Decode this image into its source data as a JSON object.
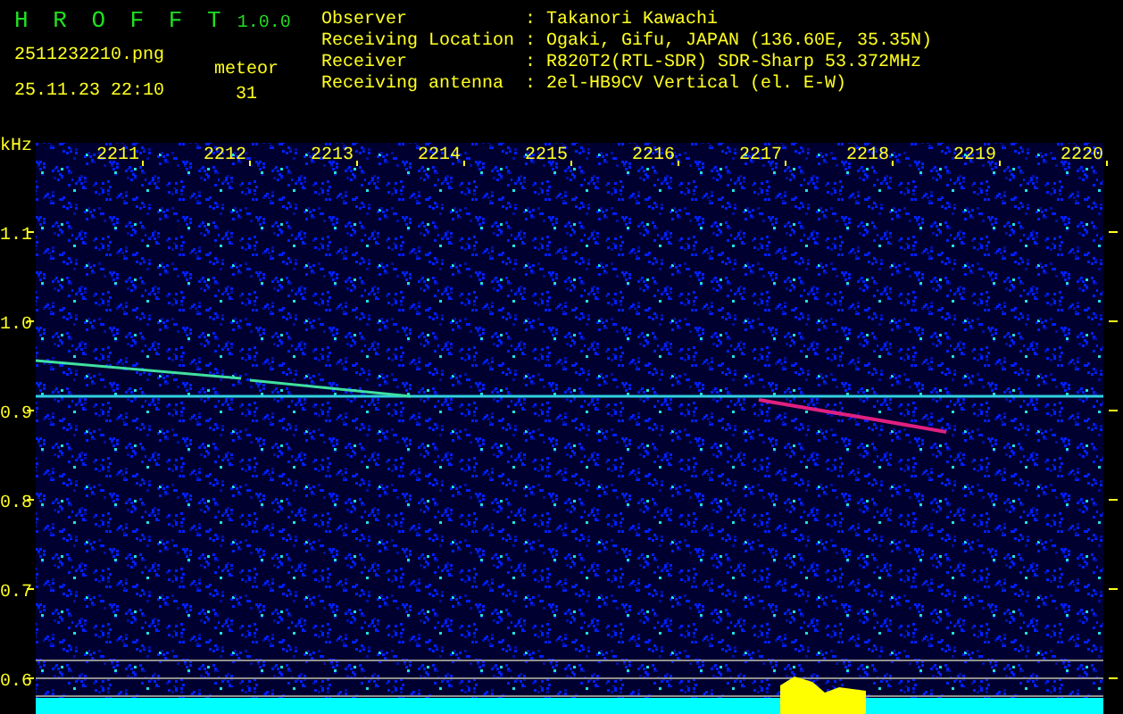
{
  "header": {
    "title": "H R O F F T",
    "version": "1.0.0",
    "filename": "2511232210.png",
    "datetime": "25.11.23 22:10",
    "meteor_label": "meteor",
    "meteor_count": "31"
  },
  "info": [
    {
      "label": "Observer",
      "separator": ":",
      "value": "Takanori Kawachi"
    },
    {
      "label": "Receiving Location",
      "separator": ":",
      "value": "Ogaki, Gifu, JAPAN (136.60E, 35.35N)"
    },
    {
      "label": "Receiver",
      "separator": ":",
      "value": "R820T2(RTL-SDR) SDR-Sharp 53.372MHz"
    },
    {
      "label": "Receiving antenna",
      "separator": ":",
      "value": "2el-HB9CV Vertical (el. E-W)"
    }
  ],
  "plot": {
    "y_unit": "kHz",
    "x_labels": [
      "2211",
      "2212",
      "2213",
      "2214",
      "2215",
      "2216",
      "2217",
      "2218",
      "2219",
      "2220"
    ],
    "y_labels": [
      "1.1",
      "1.0",
      "0.9",
      "0.8",
      "0.7",
      "0.6"
    ]
  }
}
